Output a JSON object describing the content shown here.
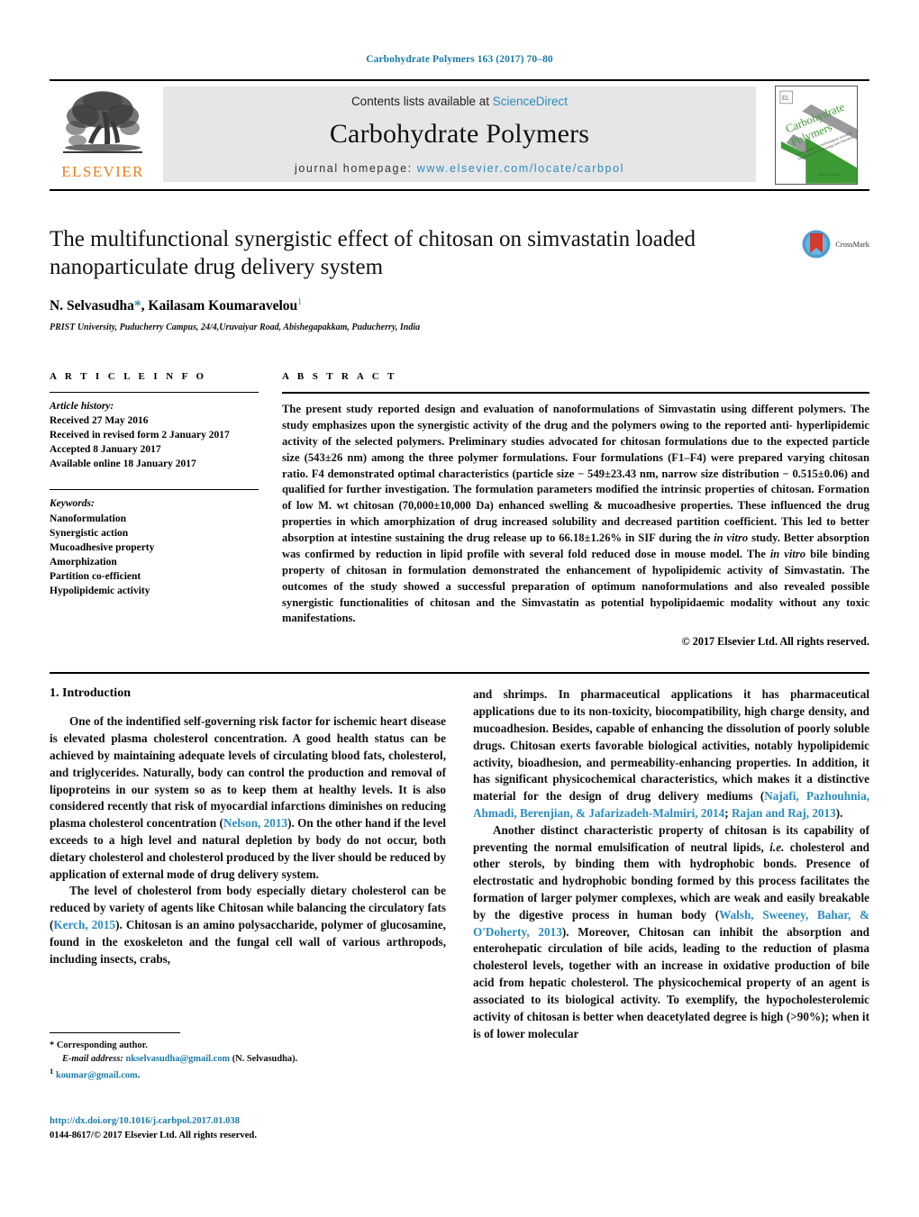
{
  "running_head": "Carbohydrate Polymers 163 (2017) 70–80",
  "colors": {
    "link": "#1a7ba8",
    "science_direct": "#2b8cbe",
    "elsevier_orange": "#ef7d1a",
    "cover_green": "#3d9b35",
    "crossmark_blue": "#4a9fd4",
    "crossmark_red": "#d33a2c"
  },
  "masthead": {
    "publisher_name": "ELSEVIER",
    "contents_prefix": "Contents lists available at ",
    "contents_link": "ScienceDirect",
    "journal_title": "Carbohydrate Polymers",
    "homepage_prefix": "journal homepage: ",
    "homepage_url": "www.elsevier.com/locate/carbpol",
    "cover_title_line1": "Carbohydrate",
    "cover_title_line2": "Polymers"
  },
  "article": {
    "title": "The multifunctional synergistic effect of chitosan on simvastatin loaded nanoparticulate drug delivery system",
    "author1": "N. Selvasudha",
    "author1_marker": "*",
    "author2": ", Kailasam Koumaravelou",
    "author2_marker": "1",
    "affiliation": "PRIST University, Puducherry Campus, 24/4,Uruvaiyar Road, Abishegapakkam, Puducherry, India",
    "crossmark_label": "CrossMark"
  },
  "article_info": {
    "heading": "A R T I C L E   I N F O",
    "history_label": "Article history:",
    "history": [
      "Received 27 May 2016",
      "Received in revised form 2 January 2017",
      "Accepted 8 January 2017",
      "Available online 18 January 2017"
    ],
    "keywords_label": "Keywords:",
    "keywords": [
      "Nanoformulation",
      "Synergistic action",
      "Mucoadhesive property",
      "Amorphization",
      "Partition co-efficient",
      "Hypolipidemic activity"
    ]
  },
  "abstract": {
    "heading": "A B S T R A C T",
    "part1": "The present study reported design and evaluation of nanoformulations of Simvastatin using different polymers. The study emphasizes upon the synergistic activity of the drug and the polymers owing to the reported anti- hyperlipidemic activity of the selected polymers. Preliminary studies advocated for chitosan formulations due to the expected particle size (543±26 nm) among the three polymer formulations. Four formulations (F1–F4) were prepared varying chitosan ratio. F4 demonstrated optimal characteristics (particle size − 549±23.43 nm, narrow size distribution − 0.515±0.06) and qualified for further investigation. The formulation parameters modified the intrinsic properties of chitosan. Formation of low M. wt chitosan (70,000±10,000 Da) enhanced swelling & mucoadhesive properties. These influenced the drug properties in which amorphization of drug increased solubility and decreased partition coefficient. This led to better absorption at intestine sustaining the drug release up to 66.18±1.26% in SIF during the ",
    "italic1": "in vitro",
    "part2": " study. Better absorption was confirmed by reduction in lipid profile with several fold reduced dose in mouse model. The ",
    "italic2": "in vitro",
    "part3": " bile binding property of chitosan in formulation demonstrated the enhancement of hypolipidemic activity of Simvastatin. The outcomes of the study showed a successful preparation of optimum nanoformulations and also revealed possible synergistic functionalities of chitosan and the Simvastatin as potential hypolipidaemic modality without any toxic manifestations.",
    "copyright": "© 2017 Elsevier Ltd. All rights reserved."
  },
  "body": {
    "section_heading": "1. Introduction",
    "left_para1_a": "One of the indentified self-governing risk factor for ischemic heart disease is elevated plasma cholesterol concentration. A good health status can be achieved by maintaining adequate levels of circulating blood fats, cholesterol, and triglycerides. Naturally, body can control the production and removal of lipoproteins in our system so as to keep them at healthy levels. It is also considered recently that risk of myocardial infarctions diminishes on reducing plasma cholesterol concentration (",
    "left_para1_cite": "Nelson, 2013",
    "left_para1_b": "). On the other hand if the level exceeds to a high level and natural depletion by body do not occur, both dietary cholesterol and cholesterol produced by the liver should be reduced by application of external mode of drug delivery system.",
    "left_para2_a": "The level of cholesterol from body especially dietary cholesterol can be reduced by variety of agents like Chitosan while balancing the circulatory fats (",
    "left_para2_cite": "Kerch, 2015",
    "left_para2_b": "). Chitosan is an amino polysaccharide, polymer of glucosamine, found in the exoskeleton and the fungal cell wall of various arthropods, including insects, crabs,",
    "right_para1_a": "and shrimps. In pharmaceutical applications it has pharmaceutical applications due to its non-toxicity, biocompatibility, high charge density, and mucoadhesion. Besides, capable of enhancing the dissolution of poorly soluble drugs. Chitosan exerts favorable biological activities, notably hypolipidemic activity, bioadhesion, and permeability-enhancing properties. In addition, it has significant physicochemical characteristics, which makes it a distinctive material for the design of drug delivery mediums (",
    "right_para1_cite1": "Najafi, Pazhouhnia, Ahmadi, Berenjian, & Jafarizadeh-Malmiri, 2014",
    "right_para1_mid": "; ",
    "right_para1_cite2": "Rajan and Raj, 2013",
    "right_para1_b": ").",
    "right_para2_a": "Another distinct characteristic property of chitosan is its capability of preventing the normal emulsification of neutral lipids, ",
    "right_para2_italic": "i.e.",
    "right_para2_b": " cholesterol and other sterols, by binding them with hydrophobic bonds. Presence of electrostatic and hydrophobic bonding formed by this process facilitates the formation of larger polymer complexes, which are weak and easily breakable by the digestive process in human body (",
    "right_para2_cite": "Walsh, Sweeney, Bahar, & O'Doherty, 2013",
    "right_para2_c": "). Moreover, Chitosan can inhibit the absorption and enterohepatic circulation of bile acids, leading to the reduction of plasma cholesterol levels, together with an increase in oxidative production of bile acid from hepatic cholesterol. The physicochemical property of an agent is associated to its biological activity. To exemplify, the hypocholesterolemic activity of chitosan is better when deacetylated degree is high (>90%); when it is of lower molecular"
  },
  "footnotes": {
    "star_marker": "*",
    "corresponding": "Corresponding author.",
    "email_label": "E-mail address:",
    "email_value": "nkselvasudha@gmail.com",
    "email_owner": "(N. Selvasudha).",
    "fn1_marker": "1",
    "fn1_email": "koumar@gmail.com",
    "fn1_tail": "."
  },
  "doi": {
    "url": "http://dx.doi.org/10.1016/j.carbpol.2017.01.038",
    "issn_line": "0144-8617/© 2017 Elsevier Ltd. All rights reserved."
  }
}
